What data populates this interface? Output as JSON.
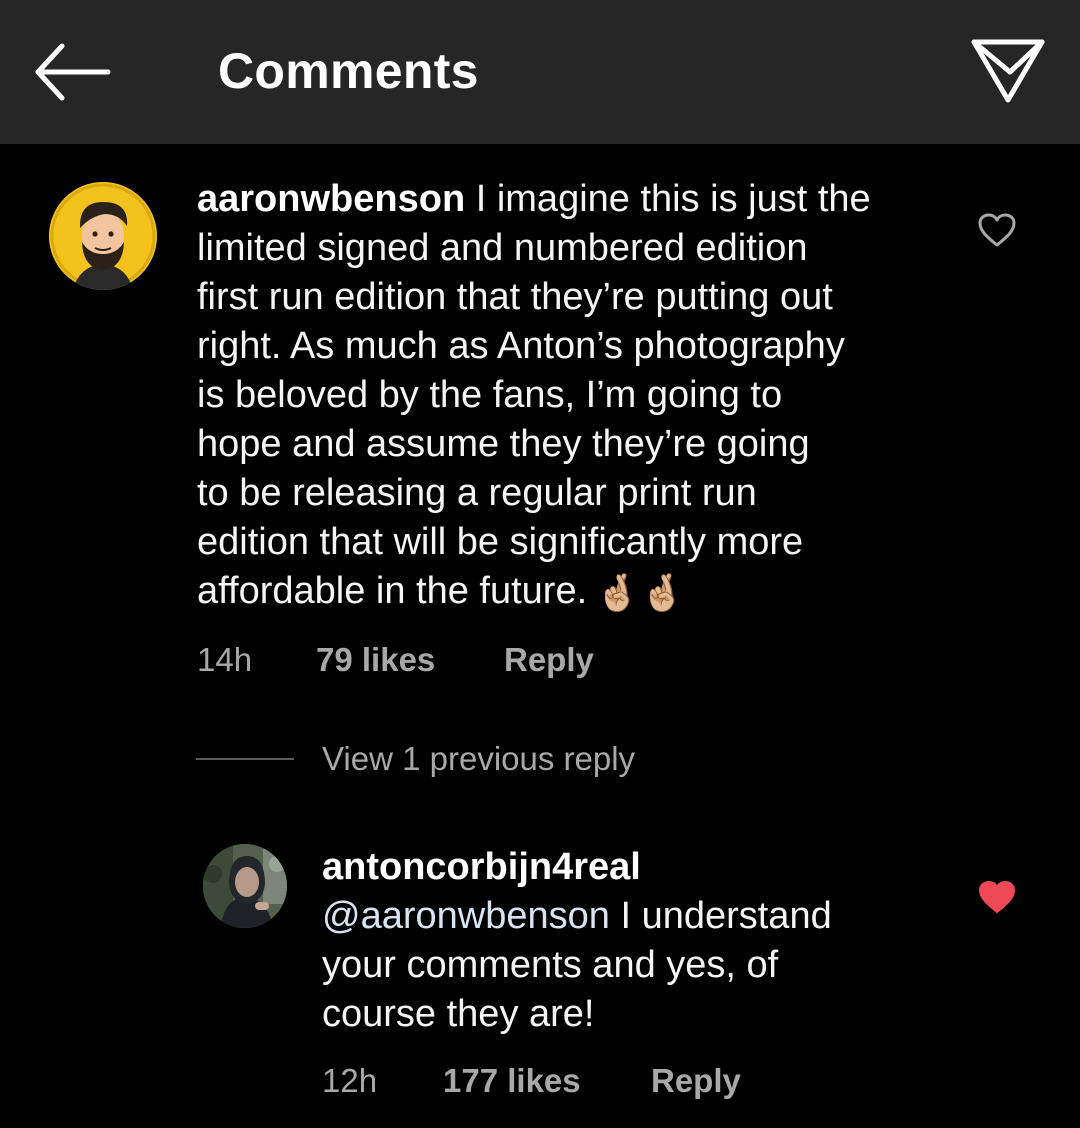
{
  "header": {
    "title": "Comments",
    "back_icon": "arrow-left-icon",
    "share_icon": "paper-plane-icon"
  },
  "comments": [
    {
      "username": "aaronwbenson",
      "text": "I imagine this is just the\nlimited signed and numbered edition\nfirst run edition that they’re putting out\nright. As much as Anton’s photography\nis beloved by the fans, I’m going to\nhope and assume they they’re going\nto be releasing a regular print run\nedition that will be significantly more\naffordable in the future.",
      "emoji": "🤞🏼🤞🏼",
      "time": "14h",
      "likes": "79 likes",
      "reply_label": "Reply",
      "liked": false,
      "avatar": "cartoon-bearded-man-avatar"
    }
  ],
  "view_replies": {
    "label": "View 1 previous reply"
  },
  "replies": [
    {
      "username": "antoncorbijn4real",
      "mention": "@aaronwbenson",
      "text": " I understand\nyour comments and yes, of\ncourse they are!",
      "time": "12h",
      "likes": "177 likes",
      "reply_label": "Reply",
      "liked": true,
      "avatar": "hooded-man-photo-avatar"
    }
  ],
  "colors": {
    "background": "#000000",
    "header_background": "#262626",
    "text": "#f5f5f5",
    "secondary_text": "#a8a8a8",
    "liked_heart": "#ed4956",
    "avatar_1_background": "#f3c21d"
  }
}
